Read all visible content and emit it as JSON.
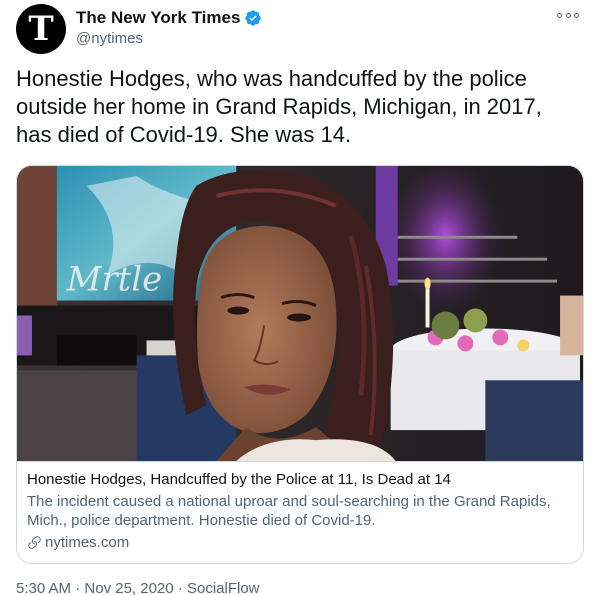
{
  "author": {
    "name": "The New York Times",
    "handle": "@nytimes",
    "avatar_letter": "T",
    "verified": true,
    "verified_color": "#1d9bf0"
  },
  "tweet": {
    "text": "Honestie Hodges, who was handcuffed by the police outside her home in Grand Rapids, Michigan, in 2017, has died of Covid-19. She was 14."
  },
  "card": {
    "title": "Honestie Hodges, Handcuffed by the Police at 11, Is Dead at 14",
    "description": "The incident caused a national uproar and soul-searching in the Grand Rapids, Mich., police department. Honestie died of Covid-19.",
    "domain": "nytimes.com",
    "image_label": "photo of a girl with braided hair at an event"
  },
  "meta": {
    "time": "5:30 AM",
    "separator": " · ",
    "date": "Nov 25, 2020",
    "source": "SocialFlow"
  },
  "icons": {
    "more": "more-horizontal-icon",
    "verified": "verified-badge-icon",
    "link": "link-icon"
  }
}
